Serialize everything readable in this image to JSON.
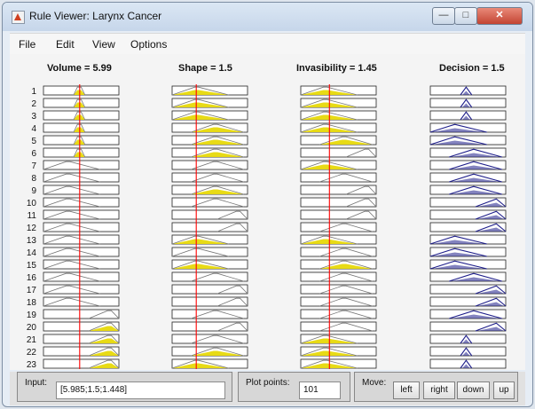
{
  "window": {
    "title": "Rule Viewer: Larynx Cancer"
  },
  "menu": {
    "items": [
      "File",
      "Edit",
      "View",
      "Options"
    ]
  },
  "headers": [
    "Volume = 5.99",
    "Shape = 1.5",
    "Invasibility = 1.45",
    "Decision = 1.5"
  ],
  "rows": [
    "1",
    "2",
    "3",
    "4",
    "5",
    "6",
    "7",
    "8",
    "9",
    "10",
    "11",
    "12",
    "13",
    "14",
    "15",
    "16",
    "17",
    "18",
    "19",
    "20",
    "21",
    "22",
    "23"
  ],
  "bottom": {
    "input_label": "Input:",
    "input_value": "[5.985;1.5;1.448]",
    "plot_points_label": "Plot points:",
    "plot_points_value": "101",
    "move_label": "Move:",
    "buttons": [
      "left",
      "right",
      "down",
      "up"
    ]
  },
  "colors": {
    "activation_fill": "#e7d90a",
    "decision_line": "#1d1d8a",
    "input_marker": "#ff0000"
  }
}
